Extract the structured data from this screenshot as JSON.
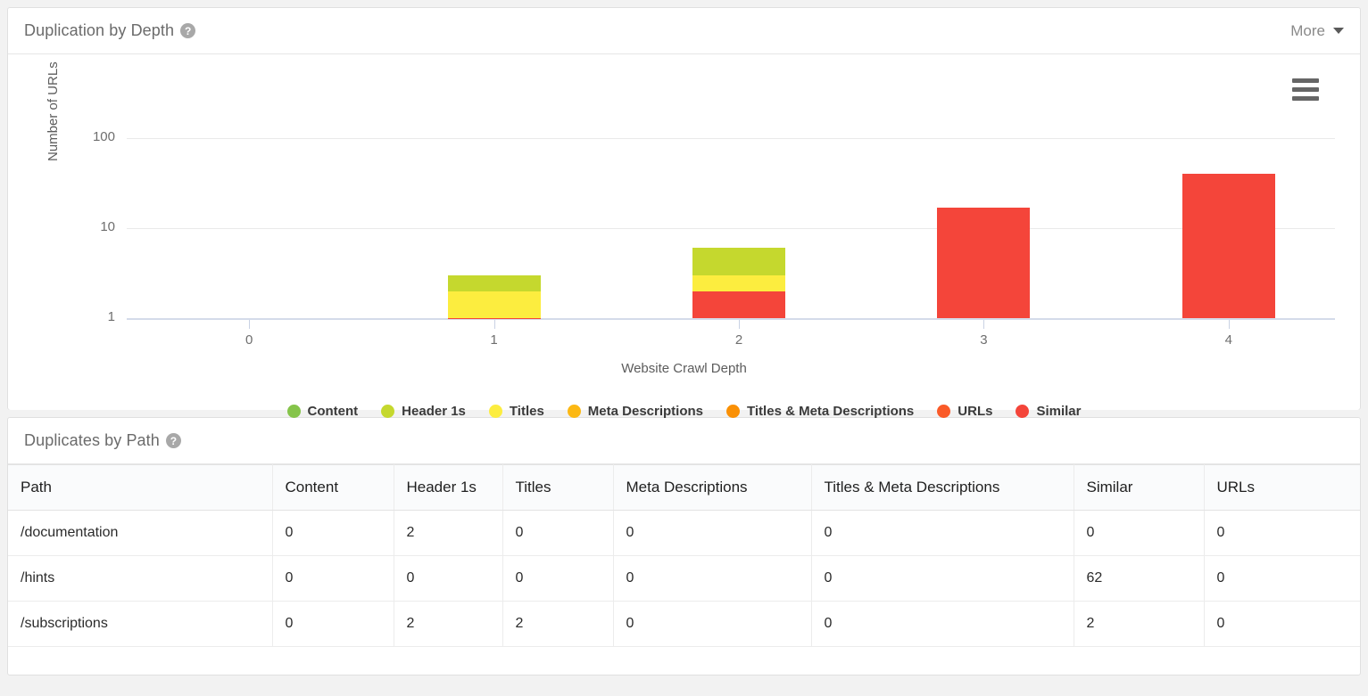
{
  "chart_panel": {
    "title": "Duplication by Depth",
    "help_icon": "help-circle-icon",
    "more_label": "More",
    "menu_icon": "hamburger-menu-icon"
  },
  "table_panel": {
    "title": "Duplicates by Path",
    "help_icon": "help-circle-icon"
  },
  "colors": {
    "content": "#85c44a",
    "header_1s": "#c5d82e",
    "titles": "#fced3f",
    "meta_descriptions": "#fcb813",
    "titles_meta_descriptions": "#fa9005",
    "urls": "#fa5a28",
    "similar": "#f4453a",
    "gridline": "#e9e9e9",
    "axis": "#d4dbea"
  },
  "chart_data": {
    "type": "bar",
    "stacked": true,
    "title": "Duplication by Depth",
    "xlabel": "Website Crawl Depth",
    "ylabel": "Number of URLs",
    "yscale": "log",
    "ylim": [
      1,
      100
    ],
    "ytick_labels": [
      "100",
      "10",
      "1"
    ],
    "ytick_values": [
      100,
      10,
      1
    ],
    "grid": true,
    "legend_position": "bottom",
    "categories": [
      "0",
      "1",
      "2",
      "3",
      "4"
    ],
    "series": [
      {
        "name": "Content",
        "color": "#85c44a",
        "values": [
          0,
          0,
          0,
          0,
          0
        ]
      },
      {
        "name": "Header 1s",
        "color": "#c5d82e",
        "values": [
          0,
          1,
          3,
          0,
          0
        ]
      },
      {
        "name": "Titles",
        "color": "#fced3f",
        "values": [
          0,
          1,
          1,
          0,
          0
        ]
      },
      {
        "name": "Meta Descriptions",
        "color": "#fcb813",
        "values": [
          0,
          0,
          0,
          0,
          0
        ]
      },
      {
        "name": "Titles & Meta Descriptions",
        "color": "#fa9005",
        "values": [
          0,
          0,
          0,
          0,
          0
        ]
      },
      {
        "name": "URLs",
        "color": "#fa5a28",
        "values": [
          0,
          0,
          0,
          0,
          0
        ]
      },
      {
        "name": "Similar",
        "color": "#f4453a",
        "values": [
          0,
          1,
          2,
          17,
          40
        ]
      }
    ],
    "totals": [
      0,
      3,
      6,
      17,
      40
    ]
  },
  "legend": [
    {
      "label": "Content",
      "color": "#85c44a"
    },
    {
      "label": "Header 1s",
      "color": "#c5d82e"
    },
    {
      "label": "Titles",
      "color": "#fced3f"
    },
    {
      "label": "Meta Descriptions",
      "color": "#fcb813"
    },
    {
      "label": "Titles & Meta Descriptions",
      "color": "#fa9005"
    },
    {
      "label": "URLs",
      "color": "#fa5a28"
    },
    {
      "label": "Similar",
      "color": "#f4453a"
    }
  ],
  "table": {
    "columns": [
      "Path",
      "Content",
      "Header 1s",
      "Titles",
      "Meta Descriptions",
      "Titles & Meta Descriptions",
      "Similar",
      "URLs"
    ],
    "rows": [
      [
        "/documentation",
        "0",
        "2",
        "0",
        "0",
        "0",
        "0",
        "0"
      ],
      [
        "/hints",
        "0",
        "0",
        "0",
        "0",
        "0",
        "62",
        "0"
      ],
      [
        "/subscriptions",
        "0",
        "2",
        "2",
        "0",
        "0",
        "2",
        "0"
      ]
    ]
  }
}
